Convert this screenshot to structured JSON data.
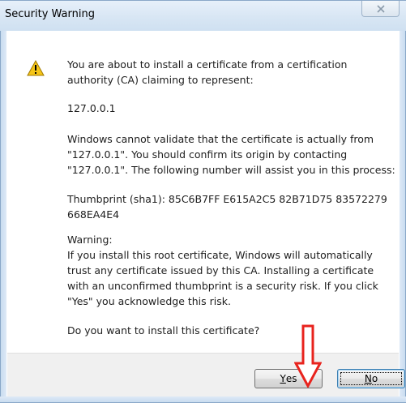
{
  "window": {
    "title": "Security Warning"
  },
  "icons": {
    "close": "close-icon",
    "warning": "warning-icon",
    "annotation": "red-down-arrow-icon"
  },
  "message": {
    "intro": "You are about to install a certificate from a certification authority (CA) claiming to represent:",
    "host": "127.0.0.1",
    "validation": "Windows cannot validate that the certificate is actually from \"127.0.0.1\". You should confirm its origin by contacting \"127.0.0.1\". The following number will assist you in this process:",
    "thumbprint": "Thumbprint (sha1): 85C6B7FF E615A2C5 82B71D75 83572279 668EA4E4",
    "warning_heading": "Warning:",
    "warning_body": "If you install this root certificate, Windows will automatically trust any certificate issued by this CA. Installing a certificate with an unconfirmed thumbprint is a security risk. If you click \"Yes\" you acknowledge this risk.",
    "question": "Do you want to install this certificate?"
  },
  "buttons": {
    "yes_mnemonic": "Y",
    "yes_rest": "es",
    "no_mnemonic": "N",
    "no_rest": "o"
  },
  "colors": {
    "annotation_arrow": "#e8231d",
    "warning_fill": "#f5c518"
  }
}
